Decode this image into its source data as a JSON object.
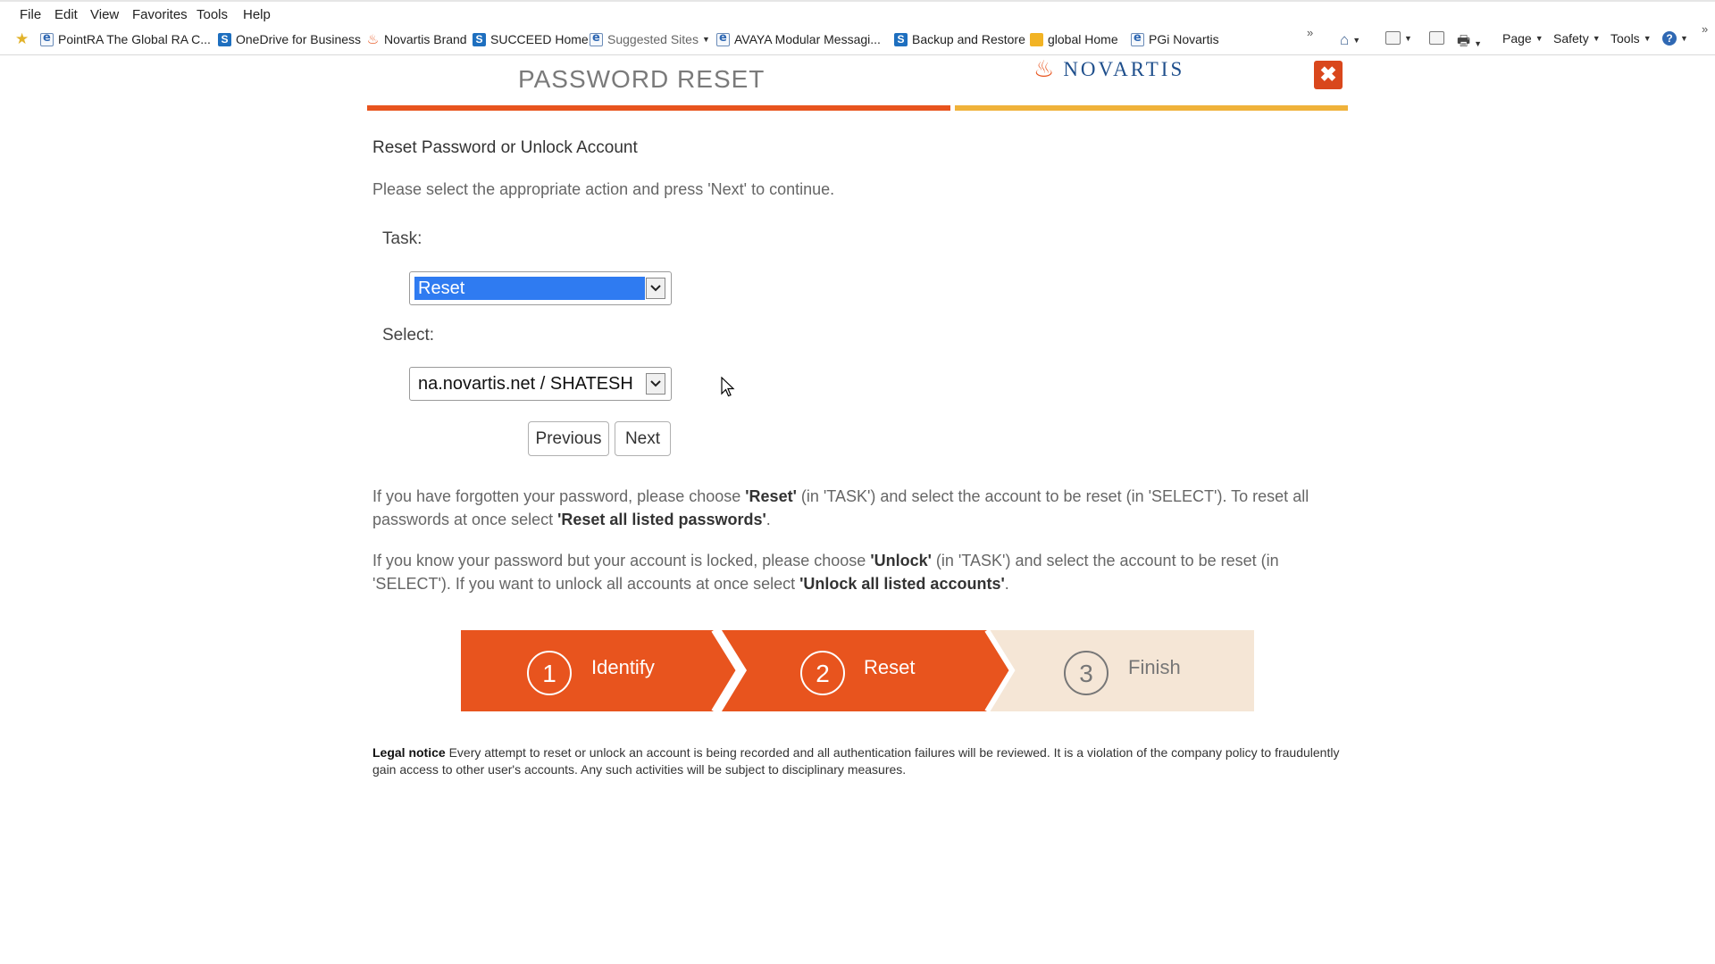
{
  "browser": {
    "menu": [
      "File",
      "Edit",
      "View",
      "Favorites",
      "Tools",
      "Help"
    ],
    "favorites": [
      {
        "label": "PointRA  The Global RA C...",
        "icon": "ie-page-icon"
      },
      {
        "label": "OneDrive for Business",
        "icon": "sharepoint-icon"
      },
      {
        "label": "Novartis Brand",
        "icon": "novartis-flame-icon"
      },
      {
        "label": "SUCCEED Home",
        "icon": "sharepoint-icon"
      },
      {
        "label": "Suggested Sites",
        "icon": "ie-page-icon"
      },
      {
        "label": "AVAYA Modular Messagi...",
        "icon": "ie-page-icon"
      },
      {
        "label": "Backup and Restore",
        "icon": "sharepoint-icon"
      },
      {
        "label": "global Home",
        "icon": "global-home-icon"
      },
      {
        "label": "PGi  Novartis",
        "icon": "ie-page-icon"
      }
    ],
    "toolbar": {
      "page": "Page",
      "safety": "Safety",
      "tools": "Tools"
    }
  },
  "header": {
    "title": "PASSWORD RESET",
    "logo_text": "NOVARTIS",
    "close_glyph": "✖"
  },
  "form": {
    "heading": "Reset Password or Unlock Account",
    "intro": "Please select the appropriate action and press 'Next' to continue.",
    "task_label": "Task:",
    "task_value": "Reset",
    "select_label": "Select:",
    "select_value": "na.novartis.net / SHATESH",
    "previous": "Previous",
    "next": "Next"
  },
  "help": {
    "p1": {
      "a": "If you have forgotten your password, please choose ",
      "b": "'Reset'",
      "c": " (in 'TASK') and select the account to be reset (in 'SELECT'). To reset all passwords at once select ",
      "d": "'Reset all listed passwords'",
      "e": "."
    },
    "p2": {
      "a": "If you know your password but your account is locked, please choose ",
      "b": "'Unlock'",
      "c": " (in 'TASK') and select the account to be reset (in 'SELECT'). If you want to unlock all accounts at once select ",
      "d": "'Unlock all listed accounts'",
      "e": "."
    }
  },
  "steps": [
    {
      "num": "1",
      "label": "Identify",
      "state": "complete"
    },
    {
      "num": "2",
      "label": "Reset",
      "state": "active"
    },
    {
      "num": "3",
      "label": "Finish",
      "state": "pending"
    }
  ],
  "legal": {
    "title": "Legal notice",
    "text": " Every attempt to reset or unlock an account is being recorded and all authentication failures will be reviewed. It is a violation of the company policy to fraudulently gain access to other user's accounts. Any such activities will be subject to disciplinary measures."
  },
  "colors": {
    "accent": "#e8541e",
    "accent_secondary": "#f0b23a",
    "step_pending": "#f5e6d6",
    "logo_blue": "#1f4f8c",
    "selection": "#2f7bf1"
  }
}
